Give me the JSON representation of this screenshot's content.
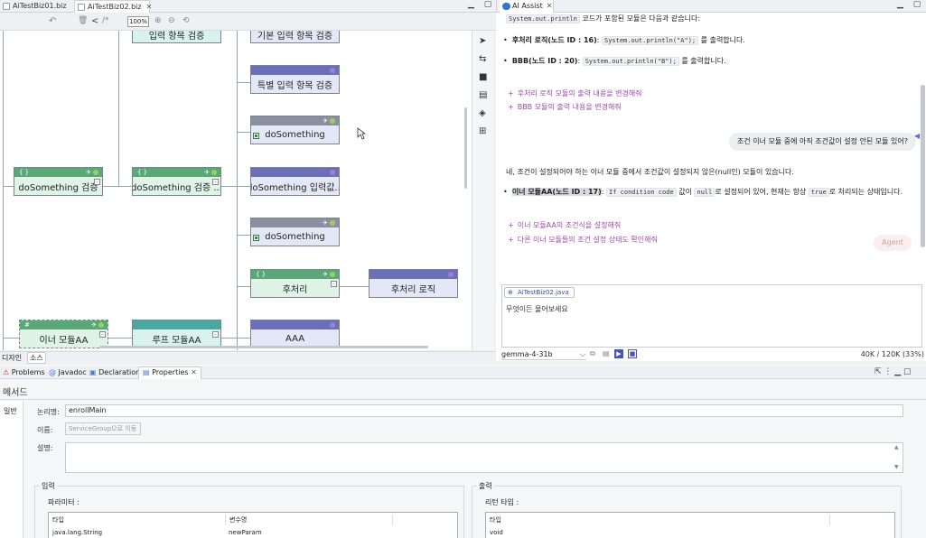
{
  "editor_tabs": [
    {
      "label": "AiTestBiz01.biz",
      "active": false
    },
    {
      "label": "AiTestBiz02.biz",
      "active": true
    }
  ],
  "toolbar": {
    "zoom": "100%"
  },
  "nodes": {
    "top_left": "입력 항목 검증",
    "top_right": "기본 입력 항목 검증",
    "special_check": "특별 입력 항목 검증",
    "do1": "doSomething",
    "verify_root": "doSomething 검증",
    "verify_child": "doSomething 검증 ...",
    "input_value": "doSomething 입력값...",
    "do2": "doSomething",
    "post": "후처리",
    "post_logic": "후처리 로직",
    "inner": "이너 모듈AA",
    "loop": "루프 모듈AA",
    "aaa": "AAA"
  },
  "canvas_tabs": [
    "디자인",
    "소스"
  ],
  "ai": {
    "tab_title": "AI Assist",
    "intro_code": "System.out.println",
    "intro_text": " 코드가 포함된 모듈은 다음과 같습니다:",
    "item1_label": "후처리 로직(노드 ID : 16)",
    "item1_code": "System.out.println(\"A\");",
    "item1_tail": " 를 출력합니다.",
    "item2_label": "BBB(노드 ID : 20)",
    "item2_code": "System.out.println(\"B\");",
    "item2_tail": " 를 출력합니다.",
    "sugg1": "후처리 로직 모듈의 출력 내용을 변경해줘",
    "sugg2": "BBB 모듈의 출력 내용을 변경해줘",
    "user_msg": "조건 이너 모듈 중에 아직 조건값이 설정 안된 모듈 있어?",
    "reply": "네, 조건이 설정되어야 하는 이너 모듈 중에서 조건값이 설정되지 않은(null인) 모듈이 있습니다.",
    "item3_label": "이너 모듈AA(노드 ID : 17)",
    "item3_colon": ": ",
    "item3_code": "If condition code",
    "item3_mid": " 값이 ",
    "item3_code2": "null",
    "item3_mid2": "로 설정되어 있어, 현재는 항상 ",
    "item3_code3": "true",
    "item3_tail": "로 처리되는 상태입니다.",
    "sugg3": "이너 모듈AA의 조건식을 설정해줘",
    "sugg4": "다른 이너 모듈들의 조건 설정 상태도 확인해줘",
    "agent_btn": "Agent",
    "context_chip": "AiTestBiz02.java",
    "input_placeholder": "무엇이든 물어보세요",
    "model": "gemma-4-31b",
    "tokens": "40K / 120K (33%)"
  },
  "bottom_tabs": [
    "Problems",
    "Javadoc",
    "Declaration",
    "Properties"
  ],
  "props": {
    "section_title": "메서드",
    "side_tab": "일반",
    "logical_name_label": "논리명:",
    "logical_name_value": "enrollMain",
    "name_label": "이름:",
    "name_button": "ServiceGroup으로 이동",
    "desc_label": "설명:",
    "input_title": "입력",
    "param_label": "파라미터 :",
    "param_headers": [
      "타입",
      "변수명"
    ],
    "param_row": [
      "java.lang.String",
      "newParam"
    ],
    "output_title": "출력",
    "return_label": "리턴 타입 :",
    "return_header": "타입",
    "return_value": "void"
  }
}
